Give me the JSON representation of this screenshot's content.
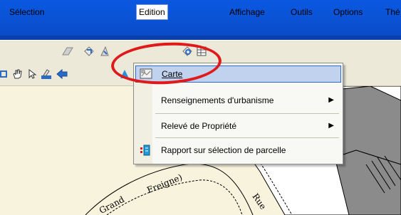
{
  "menubar": {
    "items": [
      {
        "label": "Sélection"
      },
      {
        "label": "Edition"
      },
      {
        "label": "Affichage"
      },
      {
        "label": "Outils"
      },
      {
        "label": "Options"
      },
      {
        "label": "Thé"
      }
    ]
  },
  "dropdown": {
    "items": [
      {
        "label": "Carte",
        "icon": "map-icon"
      },
      {
        "label": "Renseignements d'urbanisme",
        "icon": "none",
        "submenu": "▶"
      },
      {
        "label": "Relevé de Propriété",
        "icon": "none",
        "submenu": "▶"
      },
      {
        "label": "Rapport sur sélection de parcelle",
        "icon": "report-icon"
      }
    ]
  },
  "map": {
    "labels": [
      "Grand",
      "Freigne)",
      "Rue"
    ]
  },
  "colors": {
    "titlebar": "#0a58e0",
    "menubar": "#ece9d8",
    "highlight": "#c1d2ee",
    "annotation": "#e01a1a"
  }
}
